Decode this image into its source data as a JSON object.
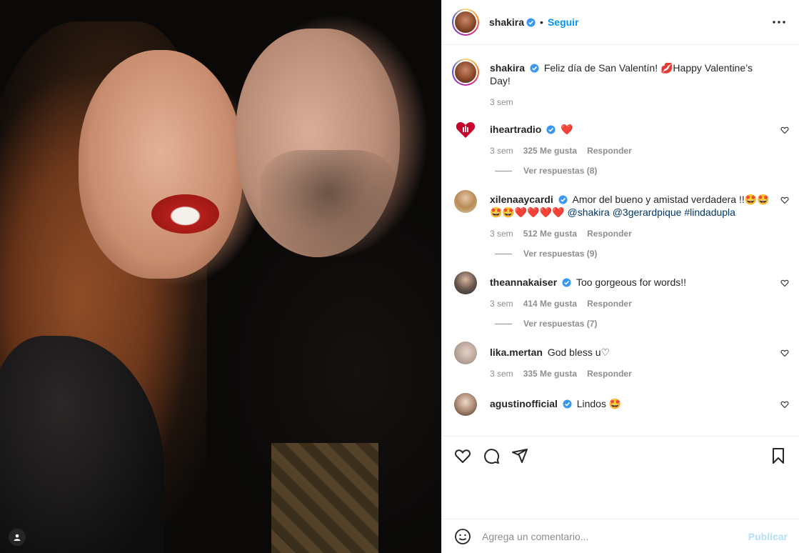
{
  "post": {
    "author": "shakira",
    "follow_label": "Seguir",
    "dot": "•",
    "caption": "Feliz día de San Valentín! 💋Happy Valentine’s Day!",
    "caption_time": "3 sem"
  },
  "comments": [
    {
      "user": "iheartradio",
      "verified": true,
      "text": "❤️",
      "time": "3 sem",
      "likes": "325 Me gusta",
      "reply": "Responder",
      "view_replies": "Ver respuestas (8)"
    },
    {
      "user": "xilenaaycardi",
      "verified": true,
      "text": "Amor del bueno y amistad verdadera !!🤩🤩",
      "text2": "🤩🤩❤️❤️❤️❤️",
      "mentions": "@shakira @3gerardpique #lindadupla",
      "time": "3 sem",
      "likes": "512 Me gusta",
      "reply": "Responder",
      "view_replies": "Ver respuestas (9)"
    },
    {
      "user": "theannakaiser",
      "verified": true,
      "text": "Too gorgeous for words!!",
      "time": "3 sem",
      "likes": "414 Me gusta",
      "reply": "Responder",
      "view_replies": "Ver respuestas (7)"
    },
    {
      "user": "lika.mertan",
      "verified": false,
      "text": "God bless u♡",
      "time": "3 sem",
      "likes": "335 Me gusta",
      "reply": "Responder"
    },
    {
      "user": "agustinofficial",
      "verified": true,
      "text": "Lindos 🤩"
    }
  ],
  "add_comment": {
    "placeholder": "Agrega un comentario...",
    "publish_label": "Publicar"
  },
  "icons": {
    "like": "heart-icon",
    "comment": "comment-icon",
    "share": "share-icon",
    "save": "bookmark-icon",
    "more": "more-icon",
    "emoji": "emoji-icon",
    "verified": "verified-badge-icon",
    "user_tag": "user-tag-icon"
  },
  "colors": {
    "accent": "#0095f6",
    "verified": "#3897f0",
    "publish_disabled": "#b2dffc",
    "mention": "#00376b"
  }
}
